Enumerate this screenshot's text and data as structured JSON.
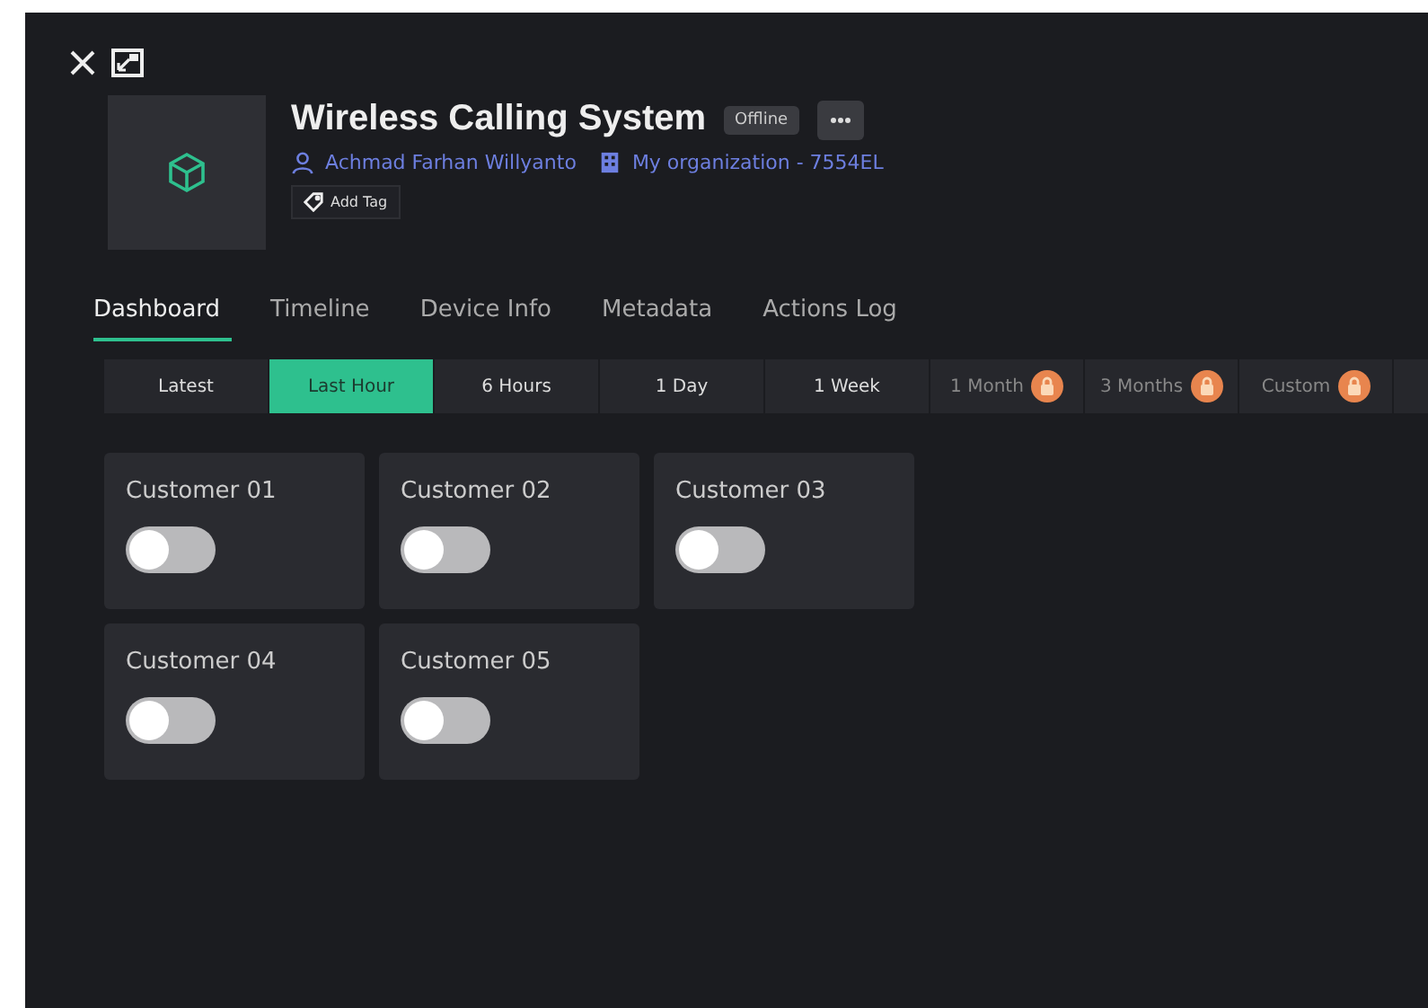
{
  "device": {
    "title": "Wireless Calling System",
    "status": "Offline",
    "owner": "Achmad Farhan Willyanto",
    "organization": "My organization - 7554EL",
    "tag_button": "Add Tag"
  },
  "tabs": [
    {
      "label": "Dashboard",
      "selected": true
    },
    {
      "label": "Timeline",
      "selected": false
    },
    {
      "label": "Device Info",
      "selected": false
    },
    {
      "label": "Metadata",
      "selected": false
    },
    {
      "label": "Actions Log",
      "selected": false
    }
  ],
  "ranges": [
    {
      "label": "Latest",
      "selected": false,
      "locked": false
    },
    {
      "label": "Last Hour",
      "selected": true,
      "locked": false
    },
    {
      "label": "6 Hours",
      "selected": false,
      "locked": false
    },
    {
      "label": "1 Day",
      "selected": false,
      "locked": false
    },
    {
      "label": "1 Week",
      "selected": false,
      "locked": false
    },
    {
      "label": "1 Month",
      "selected": false,
      "locked": true
    },
    {
      "label": "3 Months",
      "selected": false,
      "locked": true
    },
    {
      "label": "Custom",
      "selected": false,
      "locked": true
    }
  ],
  "switches": [
    {
      "label": "Customer 01",
      "checked": false
    },
    {
      "label": "Customer 02",
      "checked": false
    },
    {
      "label": "Customer 03",
      "checked": false
    },
    {
      "label": "Customer 04",
      "checked": false
    },
    {
      "label": "Customer 05",
      "checked": false
    }
  ]
}
